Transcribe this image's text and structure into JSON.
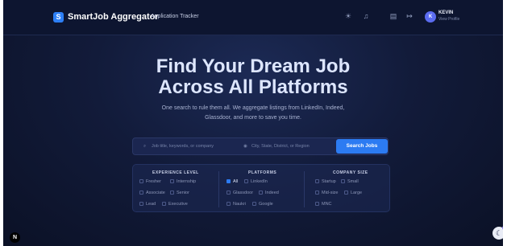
{
  "navbar": {
    "logo_letter": "S",
    "brand": "SmartJob Aggregator",
    "link": "Application Tracker",
    "icons": [
      "sun-icon",
      "bell-icon",
      "document-icon",
      "logout-icon"
    ],
    "user": {
      "initial": "K",
      "name": "KEVIN",
      "sub": "View Profile"
    }
  },
  "hero": {
    "title_line1": "Find Your Dream Job",
    "title_line2": "Across All Platforms",
    "subtitle_line1": "One search to rule them all. We aggregate listings from LinkedIn, Indeed,",
    "subtitle_line2": "Glassdoor, and more to save you time."
  },
  "search": {
    "keyword_placeholder": "Job title, keywords, or company",
    "location_placeholder": "City, State, District, or Region",
    "button": "Search Jobs"
  },
  "filters": {
    "experience": {
      "heading": "EXPERIENCE LEVEL",
      "options": [
        "Fresher",
        "Internship",
        "Associate",
        "Senior",
        "Lead",
        "Executive"
      ]
    },
    "platforms": {
      "heading": "PLATFORMS",
      "options": [
        "All",
        "LinkedIn",
        "Glassdoor",
        "Indeed",
        "Naukri",
        "Google"
      ],
      "checked": "All"
    },
    "company_size": {
      "heading": "COMPANY SIZE",
      "options": [
        "Startup",
        "Small",
        "Mid-size",
        "Large",
        "MNC"
      ]
    }
  },
  "misc": {
    "badge": "N",
    "theme_icon": "moon-icon"
  },
  "colors": {
    "accent": "#2c7bf2",
    "background": "#121b3a"
  }
}
